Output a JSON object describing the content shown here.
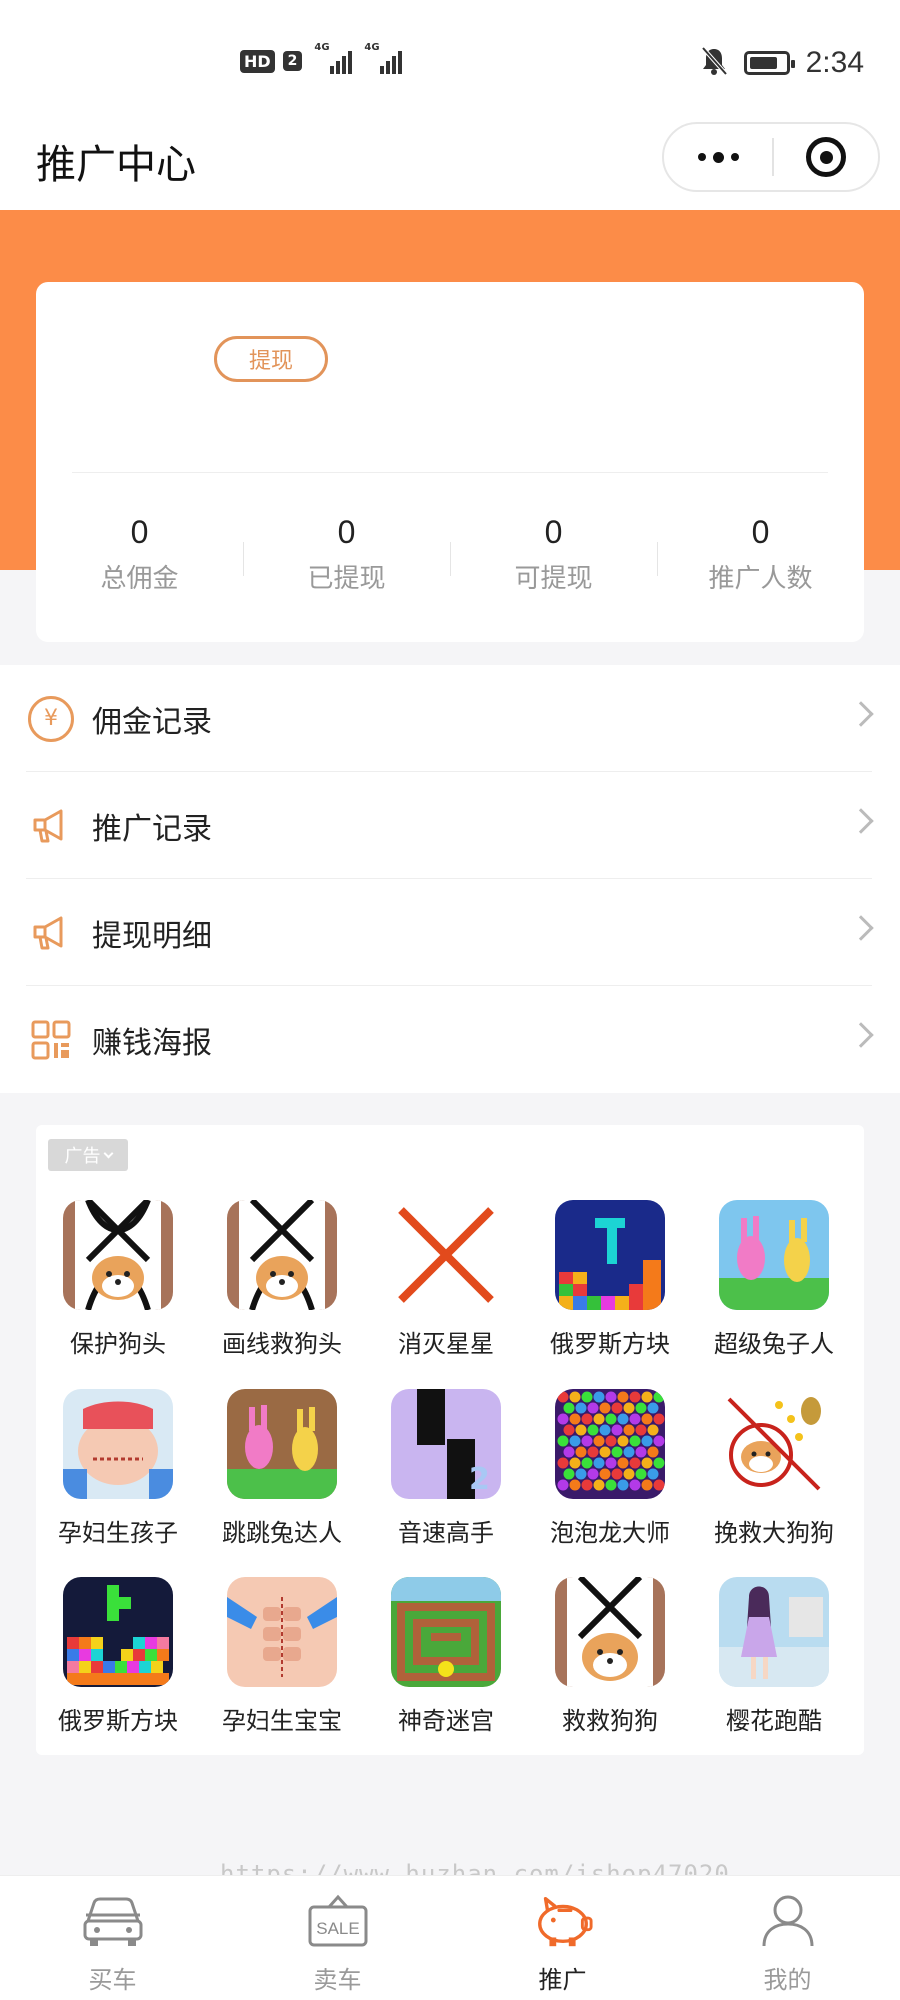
{
  "status_bar": {
    "hd": "HD",
    "sim": "2",
    "net1": "4G",
    "net2": "4G",
    "battery_level": 0.8,
    "time": "2:34"
  },
  "header": {
    "title": "推广中心"
  },
  "summary": {
    "withdraw_label": "提现",
    "stats": [
      {
        "value": "0",
        "label": "总佣金"
      },
      {
        "value": "0",
        "label": "已提现"
      },
      {
        "value": "0",
        "label": "可提现"
      },
      {
        "value": "0",
        "label": "推广人数"
      }
    ]
  },
  "menu": {
    "items": [
      {
        "label": "佣金记录",
        "icon": "yuan-icon"
      },
      {
        "label": "推广记录",
        "icon": "megaphone-icon"
      },
      {
        "label": "提现明细",
        "icon": "megaphone-icon"
      },
      {
        "label": "赚钱海报",
        "icon": "qrcode-icon"
      }
    ],
    "yuan_symbol": "¥"
  },
  "ads": {
    "tag": "广告",
    "apps": [
      {
        "name": "保护狗头"
      },
      {
        "name": "画线救狗头"
      },
      {
        "name": "消灭星星"
      },
      {
        "name": "俄罗斯方块"
      },
      {
        "name": "超级兔子人"
      },
      {
        "name": "孕妇生孩子"
      },
      {
        "name": "跳跳兔达人"
      },
      {
        "name": "音速高手"
      },
      {
        "name": "泡泡龙大师"
      },
      {
        "name": "挽救大狗狗"
      },
      {
        "name": "俄罗斯方块"
      },
      {
        "name": "孕妇生宝宝"
      },
      {
        "name": "神奇迷宫"
      },
      {
        "name": "救救狗狗"
      },
      {
        "name": "樱花跑酷"
      }
    ]
  },
  "watermark": "https://www.huzhan.com/ishop47020",
  "tabbar": {
    "tabs": [
      {
        "label": "买车",
        "icon": "car-icon"
      },
      {
        "label": "卖车",
        "icon": "sale-sign-icon",
        "sign_text": "SALE"
      },
      {
        "label": "推广",
        "icon": "piggy-bank-icon"
      },
      {
        "label": "我的",
        "icon": "person-icon"
      }
    ],
    "active_index": 2
  },
  "colors": {
    "accent": "#fc8c48",
    "accent_line": "#e89a5c"
  }
}
